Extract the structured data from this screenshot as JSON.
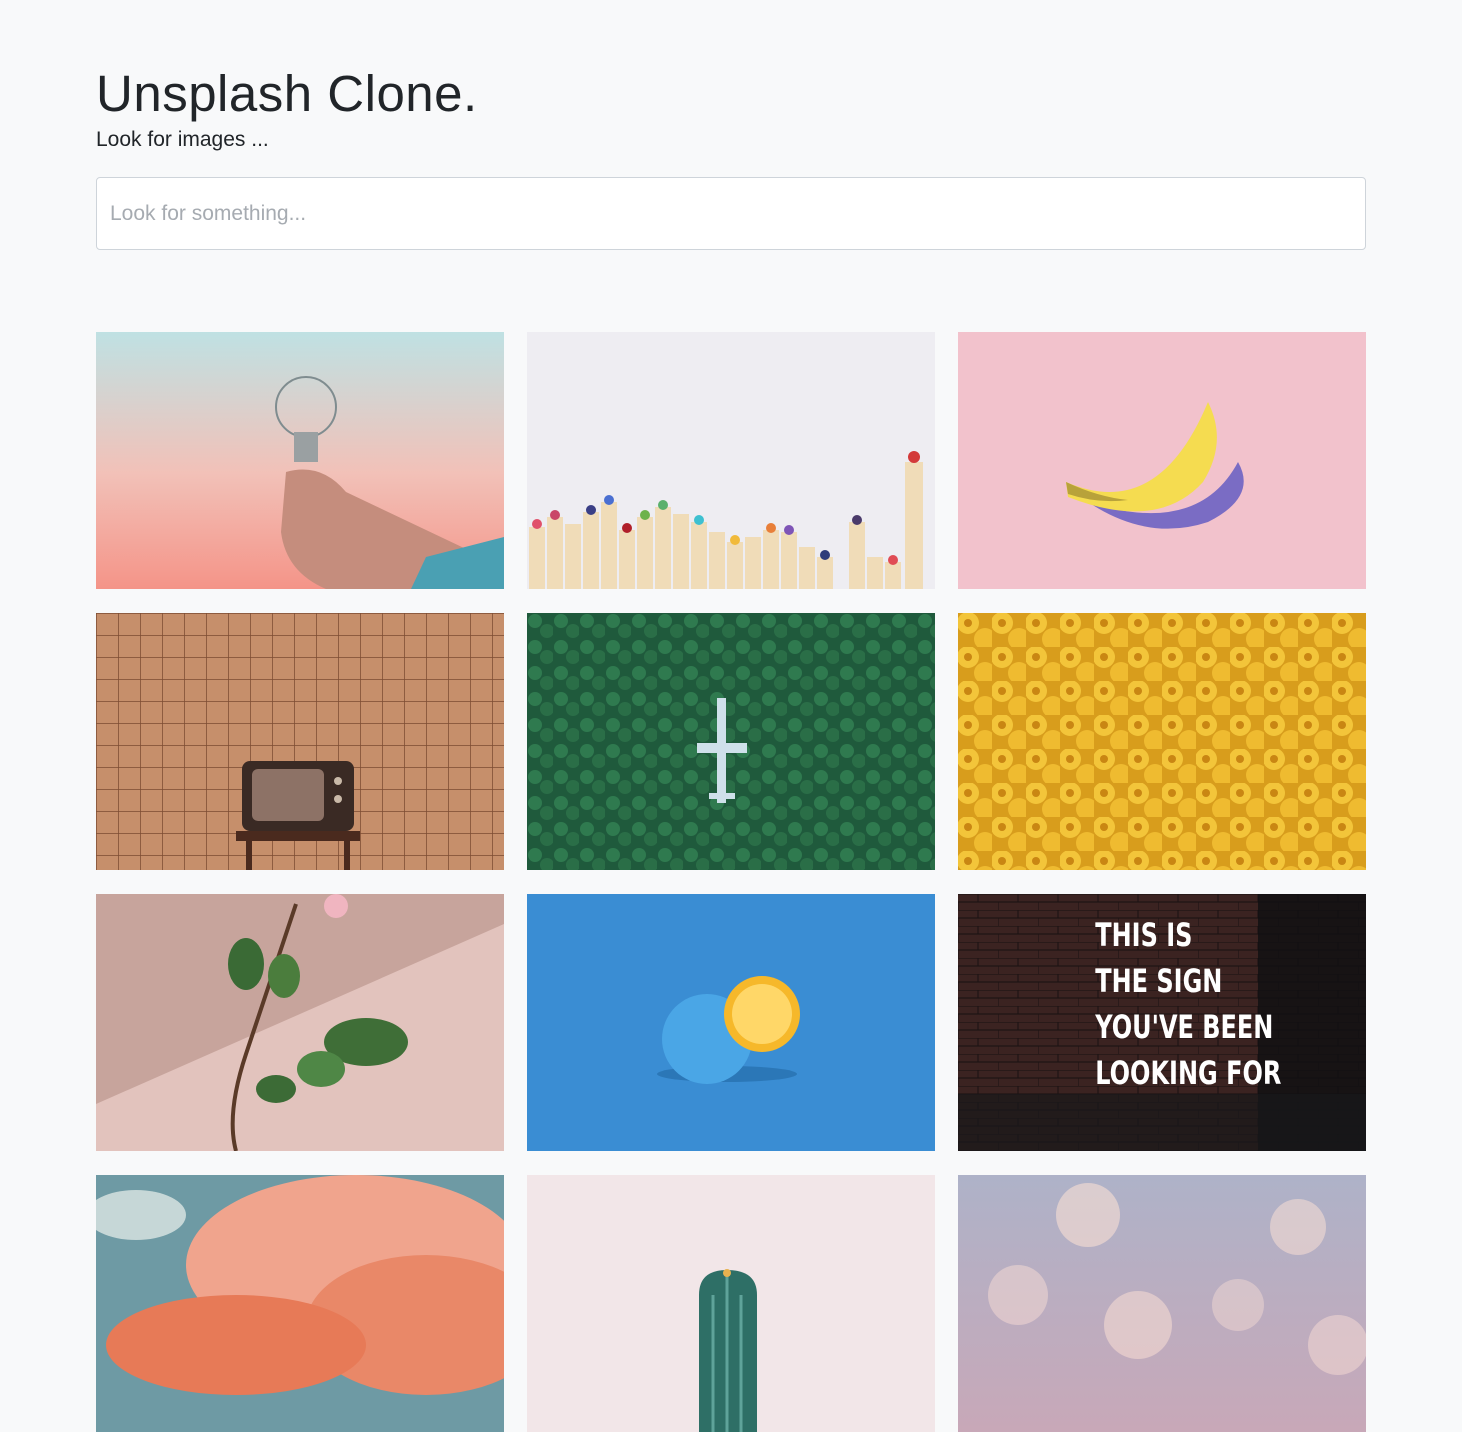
{
  "header": {
    "title": "Unsplash Clone.",
    "subtitle": "Look for images ..."
  },
  "search": {
    "placeholder": "Look for something...",
    "value": ""
  },
  "images": [
    {
      "name": "lightbulb-in-hand-image"
    },
    {
      "name": "colored-pencils-image"
    },
    {
      "name": "banana-image"
    },
    {
      "name": "vintage-tv-image"
    },
    {
      "name": "plane-in-forest-image"
    },
    {
      "name": "lego-heads-image"
    },
    {
      "name": "plant-branch-image"
    },
    {
      "name": "blue-orange-image"
    },
    {
      "name": "neon-sign-image",
      "text_lines": [
        "THIS IS",
        "THE SIGN",
        "YOU'VE BEEN",
        "LOOKING FOR"
      ]
    },
    {
      "name": "pink-clouds-image"
    },
    {
      "name": "cactus-image"
    },
    {
      "name": "bokeh-lights-image"
    }
  ]
}
